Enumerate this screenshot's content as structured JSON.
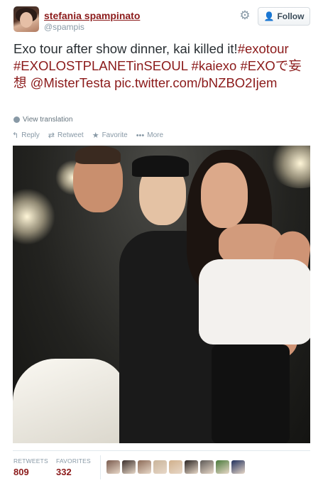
{
  "user": {
    "display_name": "stefania spampinato",
    "handle": "@spampis"
  },
  "header": {
    "follow_label": "Follow",
    "gear_icon": "gear-icon",
    "follow_icon": "add-user-icon"
  },
  "tweet": {
    "text_plain": "Exo tour after show dinner, kai killed it!",
    "hashtag_1": "#exotour",
    "hashtag_2": "#EXOLOSTPLANETinSEOUL",
    "hashtag_3": "#kaiexo",
    "hashtag_4": "#EXOで妄想",
    "mention": "@MisterTesta",
    "pic_link": "pic.twitter.com/bNZBO2Ijem",
    "view_translation": "View translation"
  },
  "actions": {
    "reply": "Reply",
    "retweet": "Retweet",
    "favorite": "Favorite",
    "more": "More"
  },
  "stats": {
    "retweets_label": "RETWEETS",
    "retweets_value": "809",
    "favorites_label": "FAVORITES",
    "favorites_value": "332"
  },
  "favoriters": [
    {
      "color": "#7a5b4e"
    },
    {
      "color": "#3b2f2c"
    },
    {
      "color": "#8c6b58"
    },
    {
      "color": "#c9b49a"
    },
    {
      "color": "#d0b08c"
    },
    {
      "color": "#2a2422"
    },
    {
      "color": "#5e5a57"
    },
    {
      "color": "#4a7a3c"
    },
    {
      "color": "#1f2f5c"
    }
  ],
  "colors": {
    "link": "#8b1a1a",
    "muted": "#8899a6",
    "text": "#292f33",
    "follow_icon": "#55acee"
  }
}
